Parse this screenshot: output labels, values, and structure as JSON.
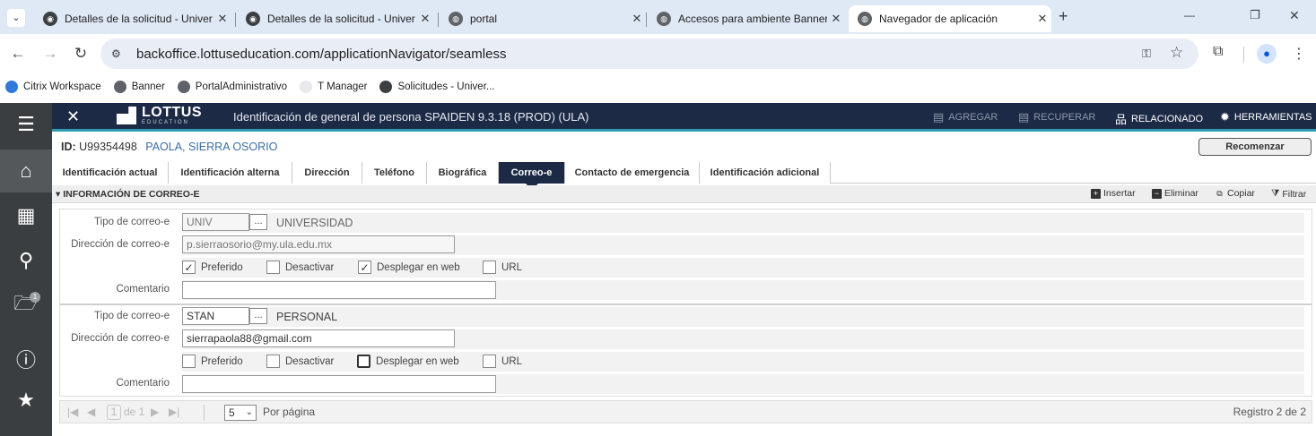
{
  "browser": {
    "tabs": [
      {
        "title": "Detalles de la solicitud - Univer",
        "active": false
      },
      {
        "title": "Detalles de la solicitud - Univer",
        "active": false
      },
      {
        "title": "portal",
        "active": false
      },
      {
        "title": "Accesos para ambiente Banner",
        "active": false
      },
      {
        "title": "Navegador de aplicación",
        "active": true
      }
    ],
    "new_tab": "+",
    "url": "backoffice.lottuseducation.com/applicationNavigator/seamless",
    "bookmarks": [
      "Citrix Workspace",
      "Banner",
      "PortalAdministrativo",
      "T Manager",
      "Solicitudes - Univer..."
    ],
    "window_controls": {
      "minimize": "—",
      "restore": "❐",
      "close": "✕"
    }
  },
  "app": {
    "close_glyph": "✕",
    "logo_text": "LOTTUS",
    "logo_sub": "EDUCATION",
    "page_title": "Identificación de general de persona SPAIDEN 9.3.18 (PROD) (ULA)",
    "actions": {
      "agregar": "AGREGAR",
      "recuperar": "RECUPERAR",
      "relacionado": "RELACIONADO",
      "herramientas": "HERRAMIENTAS"
    },
    "rail_badge": "1"
  },
  "key": {
    "id_label": "ID:",
    "id_value": "U99354498",
    "name": "PAOLA, SIERRA OSORIO",
    "restart": "Recomenzar"
  },
  "section_tabs": [
    "Identificación actual",
    "Identificación alterna",
    "Dirección",
    "Teléfono",
    "Biográfica",
    "Correo-e",
    "Contacto de emergencia",
    "Identificación adicional"
  ],
  "active_tab": "Correo-e",
  "section": {
    "title": "INFORMACIÓN DE CORREO-E",
    "insert": "Insertar",
    "delete": "Eliminar",
    "copy": "Copiar",
    "filter": "Filtrar"
  },
  "labels": {
    "type": "Tipo de correo-e",
    "address": "Dirección de correo-e",
    "preferred": "Preferido",
    "inactive": "Desactivar",
    "web": "Desplegar en web",
    "url": "URL",
    "comment": "Comentario",
    "lookup": "..."
  },
  "records": [
    {
      "type_code": "UNIV",
      "type_desc": "UNIVERSIDAD",
      "address": "p.sierraosorio@my.ula.edu.mx",
      "preferred": true,
      "inactive": false,
      "web": true,
      "url": false,
      "comment": ""
    },
    {
      "type_code": "STAN",
      "type_desc": "PERSONAL",
      "address": "sierrapaola88@gmail.com",
      "preferred": false,
      "inactive": false,
      "web": false,
      "url": false,
      "comment": ""
    }
  ],
  "pager": {
    "current_page": "1",
    "of_pages": "de 1",
    "per_page": "5",
    "per_page_label": "Por página",
    "record_status": "Registro 2 de 2"
  }
}
